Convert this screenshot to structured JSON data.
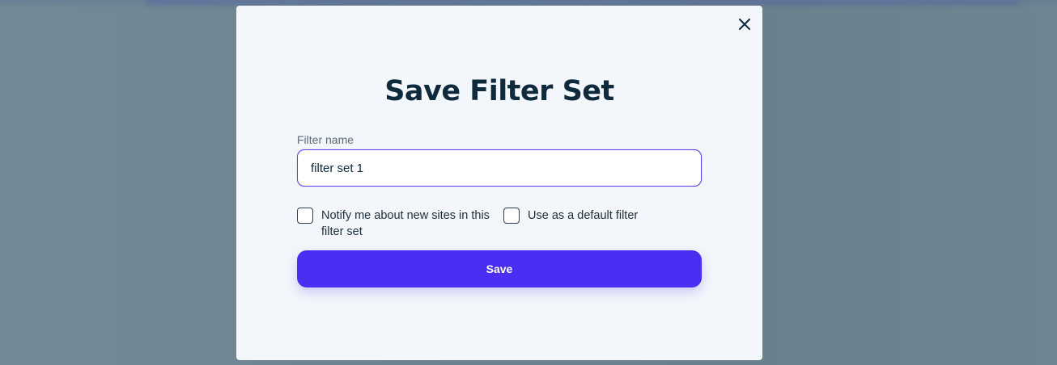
{
  "modal": {
    "title": "Save Filter Set",
    "close_icon": "close-icon"
  },
  "form": {
    "name_label": "Filter name",
    "name_value": "filter set 1",
    "name_placeholder": "",
    "notify_label": "Notify me about new sites in this filter set",
    "notify_checked": false,
    "default_label": "Use as a default filter",
    "default_checked": false,
    "save_label": "Save"
  },
  "colors": {
    "accent": "#4a2ff2",
    "title_text": "#0f2a3d",
    "modal_bg": "#f3f6fa",
    "overlay": "#6b8190"
  }
}
